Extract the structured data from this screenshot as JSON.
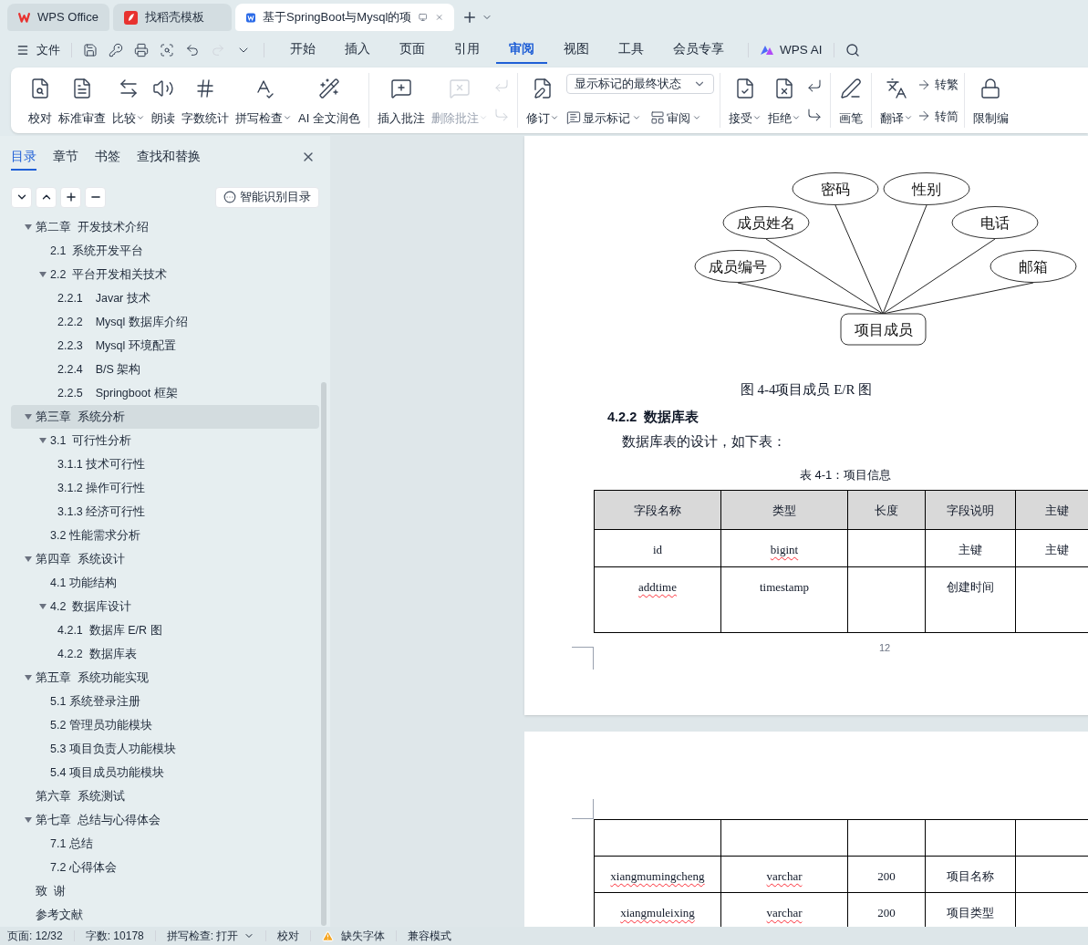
{
  "browser_tabs": [
    {
      "title": "WPS Office",
      "selected": false
    },
    {
      "title": "找稻壳模板",
      "selected": false
    },
    {
      "title": "基于SpringBoot与Mysql的项",
      "selected": true
    }
  ],
  "menu": {
    "file": "文件",
    "tabs": [
      {
        "label": "开始",
        "selected": false
      },
      {
        "label": "插入",
        "selected": false
      },
      {
        "label": "页面",
        "selected": false
      },
      {
        "label": "引用",
        "selected": false
      },
      {
        "label": "审阅",
        "selected": true
      },
      {
        "label": "视图",
        "selected": false
      },
      {
        "label": "工具",
        "selected": false
      },
      {
        "label": "会员专享",
        "selected": false
      }
    ],
    "ai": "WPS AI"
  },
  "ribbon": {
    "groups": [
      {
        "items": [
          {
            "kind": "large",
            "label": "校对",
            "dropdown": false,
            "disabled": false
          },
          {
            "kind": "large",
            "label": "标准审查",
            "dropdown": false,
            "disabled": false
          },
          {
            "kind": "large",
            "label": "比较",
            "dropdown": true,
            "disabled": false
          },
          {
            "kind": "large",
            "label": "朗读",
            "dropdown": false,
            "disabled": false
          },
          {
            "kind": "large",
            "label": "字数统计",
            "dropdown": false,
            "disabled": false
          },
          {
            "kind": "large",
            "label": "拼写检查",
            "dropdown": true,
            "disabled": false
          },
          {
            "kind": "large",
            "label": "AI 全文润色",
            "dropdown": false,
            "disabled": false
          }
        ]
      },
      {
        "items": [
          {
            "kind": "large",
            "label": "插入批注",
            "dropdown": false,
            "disabled": false
          },
          {
            "kind": "large",
            "label": "删除批注",
            "dropdown": true,
            "disabled": true
          },
          {
            "kind": "pair",
            "disabled": true
          }
        ]
      },
      {
        "items": [
          {
            "kind": "large",
            "label": "修订",
            "dropdown": true,
            "disabled": false
          },
          {
            "kind": "stack",
            "select": "显示标记的最终状态",
            "buttons": [
              {
                "label": "显示标记",
                "dropdown": true
              },
              {
                "label": "审阅",
                "dropdown": true
              }
            ]
          }
        ]
      },
      {
        "items": [
          {
            "kind": "large",
            "label": "接受",
            "dropdown": true,
            "disabled": false
          },
          {
            "kind": "large",
            "label": "拒绝",
            "dropdown": true,
            "disabled": false
          },
          {
            "kind": "pair",
            "disabled": false
          }
        ]
      },
      {
        "items": [
          {
            "kind": "large",
            "label": "画笔",
            "dropdown": false,
            "disabled": false
          }
        ]
      },
      {
        "items": [
          {
            "kind": "large",
            "label": "翻译",
            "dropdown": true,
            "disabled": false
          },
          {
            "kind": "textpair",
            "buttons": [
              {
                "label": "转繁"
              },
              {
                "label": "转简"
              }
            ]
          }
        ]
      },
      {
        "items": [
          {
            "kind": "large",
            "label": "限制编",
            "dropdown": false,
            "disabled": false
          }
        ]
      }
    ]
  },
  "sidebar": {
    "tabs": [
      {
        "label": "目录",
        "selected": true
      },
      {
        "label": "章节",
        "selected": false
      },
      {
        "label": "书签",
        "selected": false
      },
      {
        "label": "查找和替换",
        "selected": false
      }
    ],
    "smart_button": "智能识别目录",
    "tree": [
      {
        "label": "第二章  开发技术介绍",
        "selected": false,
        "expanded": true,
        "children": [
          {
            "label": "2.1  系统开发平台",
            "selected": false
          },
          {
            "label": "2.2  平台开发相关技术",
            "selected": false,
            "expanded": true,
            "children": [
              {
                "label": "2.2.1    Javar 技术",
                "selected": false
              },
              {
                "label": "2.2.2    Mysql 数据库介绍",
                "selected": false
              },
              {
                "label": "2.2.3    Mysql 环境配置",
                "selected": false
              },
              {
                "label": "2.2.4    B/S 架构",
                "selected": false
              },
              {
                "label": "2.2.5    Springboot 框架",
                "selected": false
              }
            ]
          }
        ]
      },
      {
        "label": "第三章  系统分析",
        "selected": true,
        "expanded": true,
        "children": [
          {
            "label": "3.1  可行性分析",
            "selected": false,
            "expanded": true,
            "children": [
              {
                "label": "3.1.1 技术可行性",
                "selected": false
              },
              {
                "label": "3.1.2 操作可行性",
                "selected": false
              },
              {
                "label": "3.1.3 经济可行性",
                "selected": false
              }
            ]
          },
          {
            "label": "3.2 性能需求分析",
            "selected": false
          }
        ]
      },
      {
        "label": "第四章  系统设计",
        "selected": false,
        "expanded": true,
        "children": [
          {
            "label": "4.1 功能结构",
            "selected": false
          },
          {
            "label": "4.2  数据库设计",
            "selected": false,
            "expanded": true,
            "children": [
              {
                "label": "4.2.1  数据库 E/R 图",
                "selected": false
              },
              {
                "label": "4.2.2  数据库表",
                "selected": false
              }
            ]
          }
        ]
      },
      {
        "label": "第五章  系统功能实现",
        "selected": false,
        "expanded": true,
        "children": [
          {
            "label": "5.1 系统登录注册",
            "selected": false
          },
          {
            "label": "5.2 管理员功能模块",
            "selected": false
          },
          {
            "label": "5.3 项目负责人功能模块",
            "selected": false
          },
          {
            "label": "5.4 项目成员功能模块",
            "selected": false
          }
        ]
      },
      {
        "label": "第六章  系统测试",
        "selected": false
      },
      {
        "label": "第七章  总结与心得体会",
        "selected": false,
        "expanded": true,
        "children": [
          {
            "label": "7.1 总结",
            "selected": false
          },
          {
            "label": "7.2 心得体会",
            "selected": false
          }
        ]
      },
      {
        "label": "致  谢",
        "selected": false
      },
      {
        "label": "参考文献",
        "selected": false
      }
    ]
  },
  "document": {
    "er_diagram": {
      "entity": "项目成员",
      "attributes": [
        "密码",
        "性别",
        "成员姓名",
        "电话",
        "成员编号",
        "邮箱"
      ]
    },
    "figure_caption": "图 4-4项目成员 E/R 图",
    "heading": "4.2.2  数据库表",
    "paragraph": "数据库表的设计，如下表：",
    "table_caption": "表 4-1：项目信息",
    "table": {
      "columns": [
        "字段名称",
        "类型",
        "长度",
        "字段说明",
        "主键"
      ],
      "rows": [
        {
          "field_name": {
            "text": "id",
            "misspelled": false
          },
          "type": {
            "text": "bigint",
            "misspelled": true
          },
          "description": {
            "text": "主键",
            "misspelled": false
          },
          "primary_key": {
            "text": "主键",
            "misspelled": false
          }
        },
        {
          "field_name": {
            "text": "addtime",
            "misspelled": true
          },
          "type": {
            "text": "timestamp",
            "misspelled": false
          },
          "description": {
            "text": "创建时间",
            "misspelled": false
          }
        }
      ]
    },
    "page_number": "12",
    "next_page_rows": [
      {},
      {
        "field_name": {
          "text": "xiangmumingcheng",
          "misspelled": true
        },
        "type": {
          "text": "varchar",
          "misspelled": true
        },
        "length": {
          "text": "200",
          "misspelled": false
        },
        "description": {
          "text": "项目名称",
          "misspelled": false
        }
      },
      {
        "field_name": {
          "text": "xiangmuleixing",
          "misspelled": true
        },
        "type": {
          "text": "varchar",
          "misspelled": true
        },
        "length": {
          "text": "200",
          "misspelled": false
        },
        "description": {
          "text": "项目类型",
          "misspelled": false
        }
      }
    ]
  },
  "status_bar": [
    {
      "kind": "text",
      "label": "页面: 12/32"
    },
    {
      "kind": "text",
      "label": "字数: 10178"
    },
    {
      "kind": "dropdown",
      "label": "拼写检查: 打开"
    },
    {
      "kind": "text",
      "label": "校对"
    },
    {
      "kind": "warning",
      "label": "缺失字体"
    },
    {
      "kind": "text",
      "label": "兼容模式"
    }
  ]
}
